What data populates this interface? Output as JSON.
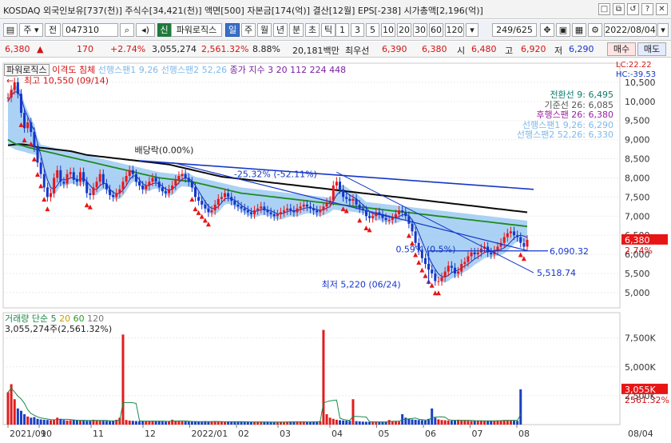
{
  "window": {
    "title": "KOSDAQ 외국인보유[737(천)] 주식수[34,421(천)] 액면[500] 자본금[174(억)] 결산[12월] EPS[-238] 시가총액[2,196(억)]",
    "buttons": [
      "□",
      "⧉",
      "↺",
      "?",
      "✕"
    ]
  },
  "toolbar": {
    "stock_mode": "주",
    "market": "전",
    "code": "047310",
    "chart_name_badge": "신",
    "chart_name": "파워로직스",
    "periods": [
      "일",
      "주",
      "월",
      "년",
      "분",
      "초",
      "틱"
    ],
    "selected_period": "일",
    "intervals": [
      "1",
      "3",
      "5",
      "10",
      "20",
      "30",
      "60",
      "120"
    ],
    "count_value": "249/625",
    "date_value": "2022/08/04"
  },
  "quote": {
    "price": "6,380",
    "change": "170",
    "change_pct": "+2.74%",
    "volume": "3,055,274",
    "volume_ratio": "2,561.32%",
    "turnover": "8.88%",
    "amount": "20,181백만",
    "best_label": "최우선",
    "best_ask": "6,390",
    "best_bid": "6,380",
    "open_label": "시",
    "open": "6,480",
    "high_label": "고",
    "high": "6,920",
    "low_label": "저",
    "low": "6,290",
    "sell_button": "매수",
    "buy_button": "매도"
  },
  "colors": {
    "up": "#e8161a",
    "down": "#1536c8",
    "ma5": "#1a2fb5",
    "ma26": "#0a0a0a",
    "cloud": "#8fc3f0",
    "green_line": "#1f8a1f",
    "volume_up": "#e11d1d",
    "volume_down": "#1b3fc2"
  },
  "chart_data": {
    "type": "line",
    "title": "",
    "price_legend": [
      {
        "text": "파워로직스",
        "color": "#222222"
      },
      {
        "text": "이격도 침체",
        "color": "#d21414"
      },
      {
        "text": "선행스팬1 9,26",
        "color": "#7fb8ea"
      },
      {
        "text": "선행스팬2 52,26",
        "color": "#7fb8ea"
      },
      {
        "text": "종가 지수 3 20 112 224 448",
        "color": "#7a1fa2"
      }
    ],
    "indicator_legend": [
      {
        "text": "전환선 9: 6,495",
        "color": "#0e7a6a"
      },
      {
        "text": "기준선 26: 6,085",
        "color": "#555555"
      },
      {
        "text": "후행스팬 26: 6,380",
        "color": "#9b1fa2"
      },
      {
        "text": "선행스팬1 9,26: 6,290",
        "color": "#7fb8ea"
      },
      {
        "text": "선행스팬2 52,26: 6,330",
        "color": "#7fb8ea"
      }
    ],
    "corner_labels": [
      "LC:22.22",
      "HC:-39.53"
    ],
    "price_axis": {
      "ylim": [
        4600,
        11000
      ],
      "ticks": [
        "10,500",
        "10,000",
        "9,500",
        "9,000",
        "8,500",
        "8,000",
        "7,500",
        "7,000",
        "6,500",
        "6,000",
        "5,500",
        "5,000"
      ],
      "current_price": "6,380",
      "current_pct": "2.74%"
    },
    "x_axis": {
      "ticks": [
        "2021/09",
        "10",
        "11",
        "12",
        "2022/01",
        "02",
        "03",
        "04",
        "05",
        "06",
        "07",
        "08"
      ],
      "right_date": "08/04"
    },
    "annotations": {
      "high": "최고 10,550 (09/14)",
      "low": "최저 5,220 (06/24)",
      "dividend": "배당락(0.00%)",
      "trend_upper": "-25.32% (-52.11%)",
      "trend_mid": "0.59% (0.5%)",
      "level_6090": "6,090.32",
      "level_5518": "5,518.74"
    },
    "close_series": [
      10100,
      10300,
      10500,
      10200,
      9700,
      9300,
      9450,
      9200,
      8800,
      8400,
      8100,
      7750,
      7500,
      7600,
      8000,
      8200,
      7900,
      7850,
      8100,
      8150,
      7950,
      7900,
      8150,
      7900,
      7600,
      7550,
      7750,
      7900,
      8100,
      7850,
      7700,
      7550,
      7500,
      7600,
      7700,
      7900,
      8050,
      8200,
      8100,
      7900,
      7800,
      7700,
      7800,
      7900,
      8000,
      7900,
      7750,
      7650,
      7600,
      7700,
      7800,
      7950,
      8050,
      8100,
      8000,
      7900,
      7750,
      7500,
      7400,
      7300,
      7200,
      7100,
      7150,
      7300,
      7450,
      7500,
      7600,
      7500,
      7400,
      7300,
      7250,
      7200,
      7150,
      7100,
      7050,
      7150,
      7200,
      7250,
      7150,
      7100,
      7050,
      7000,
      7050,
      7100,
      7150,
      7200,
      7150,
      7100,
      7200,
      7250,
      7300,
      7250,
      7200,
      7150,
      7100,
      7150,
      7250,
      7350,
      7400,
      7800,
      7900,
      7700,
      7500,
      7450,
      7400,
      7450,
      7300,
      7200,
      7150,
      7000,
      6950,
      7000,
      7100,
      7050,
      6950,
      6900,
      6900,
      6950,
      7050,
      7150,
      7100,
      7000,
      6800,
      6600,
      6300,
      6100,
      5900,
      5750,
      5600,
      5500,
      5300,
      5300,
      5400,
      5550,
      5700,
      5650,
      5500,
      5550,
      5750,
      5800,
      5950,
      6050,
      6000,
      6050,
      6150,
      6200,
      6050,
      6000,
      6100,
      6200,
      6300,
      6450,
      6550,
      6600,
      6500,
      6450,
      6300,
      6200,
      6380
    ],
    "ma5_series": [
      10000,
      10150,
      10250,
      10250,
      10100,
      9800,
      9600,
      9400,
      9250,
      8900,
      8600,
      8250,
      7950,
      7750,
      7700,
      7800,
      7950,
      7950,
      7950,
      8000,
      8000,
      7950,
      7950,
      8000,
      7900,
      7800,
      7700,
      7700,
      7800,
      7850,
      7850,
      7700,
      7620,
      7580,
      7600,
      7680,
      7800,
      7950,
      8050,
      8050,
      7950,
      7850,
      7800,
      7800,
      7850,
      7870,
      7850,
      7780,
      7700,
      7680,
      7700,
      7780,
      7880,
      7960,
      8000,
      7980,
      7920,
      7800,
      7660,
      7520,
      7380,
      7260,
      7200,
      7200,
      7250,
      7350,
      7450,
      7470,
      7450,
      7410,
      7360,
      7280,
      7230,
      7180,
      7130,
      7120,
      7140,
      7170,
      7180,
      7160,
      7140,
      7100,
      7060,
      7060,
      7080,
      7120,
      7140,
      7140,
      7150,
      7170,
      7200,
      7220,
      7220,
      7200,
      7170,
      7150,
      7170,
      7210,
      7250,
      7400,
      7550,
      7640,
      7660,
      7610,
      7550,
      7500,
      7450,
      7370,
      7300,
      7210,
      7120,
      7070,
      7040,
      7040,
      7020,
      7000,
      6980,
      6960,
      6960,
      6990,
      7030,
      7050,
      7010,
      6900,
      6760,
      6560,
      6340,
      6130,
      5930,
      5760,
      5610,
      5490,
      5420,
      5410,
      5450,
      5520,
      5560,
      5590,
      5640,
      5700,
      5740,
      5810,
      5880,
      5930,
      5990,
      6050,
      6070,
      6080,
      6100,
      6110,
      6130,
      6170,
      6240,
      6330,
      6420,
      6480,
      6500,
      6480,
      6440
    ],
    "ma26_series": [
      8850,
      8860,
      8870,
      8880,
      8880,
      8870,
      8860,
      8840,
      8820,
      8800,
      8790,
      8780,
      8770,
      8760,
      8750,
      8740,
      8730,
      8720,
      8710,
      8700,
      8680,
      8660,
      8640,
      8620,
      8600,
      8590,
      8580,
      8570,
      8560,
      8550,
      8540,
      8530,
      8520,
      8510,
      8500,
      8490,
      8480,
      8470,
      8460,
      8450,
      8440,
      8430,
      8420,
      8410,
      8400,
      8390,
      8380,
      8370,
      8360,
      8350,
      8330,
      8310,
      8290,
      8270,
      8250,
      8230,
      8210,
      8190,
      8170,
      8150,
      8130,
      8110,
      8090,
      8070,
      8050,
      8030,
      8020,
      8010,
      8000,
      7990,
      7980,
      7970,
      7960,
      7950,
      7940,
      7930,
      7920,
      7910,
      7900,
      7890,
      7880,
      7870,
      7860,
      7850,
      7840,
      7830,
      7820,
      7810,
      7800,
      7790,
      7780,
      7770,
      7760,
      7750,
      7740,
      7730,
      7720,
      7710,
      7700,
      7690,
      7680,
      7670,
      7660,
      7650,
      7640,
      7630,
      7620,
      7610,
      7600,
      7590,
      7580,
      7570,
      7560,
      7550,
      7540,
      7530,
      7520,
      7510,
      7500,
      7490,
      7480,
      7470,
      7460,
      7450,
      7440,
      7430,
      7420,
      7410,
      7400,
      7390,
      7380,
      7370,
      7360,
      7350,
      7340,
      7330,
      7320,
      7310,
      7300,
      7290,
      7280,
      7270,
      7260,
      7250,
      7240,
      7230,
      7220,
      7210,
      7200,
      7190,
      7180,
      7170,
      7160,
      7150,
      7140,
      7130,
      7120,
      7110,
      7100
    ],
    "green_series": [
      9000,
      8950,
      8900,
      8870,
      8850,
      8830,
      8800,
      8780,
      8760,
      8740,
      8720,
      8700,
      8680,
      8660,
      8640,
      8620,
      8600,
      8580,
      8560,
      8540,
      8520,
      8500,
      8480,
      8460,
      8440,
      8420,
      8400,
      8380,
      8360,
      8340,
      8320,
      8300,
      8280,
      8260,
      8240,
      8220,
      8200,
      8180,
      8160,
      8140,
      8120,
      8100,
      8080,
      8060,
      8040,
      8020,
      8000,
      7990,
      7980,
      7970,
      7960,
      7950,
      7940,
      7930,
      7920,
      7910,
      7900,
      7880,
      7860,
      7840,
      7820,
      7800,
      7780,
      7760,
      7740,
      7720,
      7700,
      7680,
      7660,
      7640,
      7620,
      7600,
      7590,
      7580,
      7570,
      7560,
      7550,
      7540,
      7530,
      7520,
      7510,
      7500,
      7490,
      7480,
      7470,
      7460,
      7450,
      7440,
      7430,
      7420,
      7410,
      7400,
      7390,
      7380,
      7370,
      7360,
      7350,
      7340,
      7330,
      7320,
      7310,
      7300,
      7290,
      7280,
      7270,
      7260,
      7250,
      7240,
      7230,
      7220,
      7210,
      7200,
      7190,
      7180,
      7170,
      7160,
      7150,
      7140,
      7130,
      7120,
      7110,
      7100,
      7090,
      7080,
      7070,
      7060,
      7050,
      7040,
      7030,
      7020,
      7010,
      7000,
      6990,
      6980,
      6970,
      6960,
      6950,
      6940,
      6930,
      6920,
      6910,
      6900,
      6890,
      6880,
      6870,
      6860,
      6850,
      6840,
      6830,
      6820,
      6810,
      6800,
      6790,
      6780,
      6770,
      6760,
      6750,
      6740,
      6730
    ],
    "volume_legend": [
      {
        "text": "거래량",
        "color": "#1a8a4a"
      },
      {
        "text": "단순 5",
        "color": "#1a8a4a"
      },
      {
        "text": "20",
        "color": "#c8a000"
      },
      {
        "text": "60",
        "color": "#2a9a2a"
      },
      {
        "text": "120",
        "color": "#777777"
      }
    ],
    "volume_label": "3,055,274주(2,561.32%)",
    "volume_axis": {
      "ylim": [
        0,
        9000
      ],
      "ticks": [
        "7,500K",
        "5,000K",
        "2,500K"
      ],
      "current": "3,055K",
      "current_pct": "2561.32%"
    },
    "volume_series": [
      2800,
      3500,
      2200,
      1400,
      1200,
      900,
      700,
      600,
      650,
      500,
      450,
      420,
      400,
      380,
      420,
      600,
      500,
      400,
      350,
      380,
      400,
      380,
      360,
      350,
      330,
      340,
      420,
      380,
      360,
      340,
      320,
      300,
      320,
      420,
      600,
      7800,
      400,
      350,
      330,
      310,
      300,
      280,
      300,
      320,
      340,
      300,
      280,
      270,
      260,
      300,
      420,
      320,
      300,
      290,
      280,
      270,
      260,
      250,
      240,
      260,
      300,
      280,
      270,
      260,
      250,
      240,
      230,
      250,
      260,
      270,
      250,
      240,
      230,
      220,
      230,
      240,
      250,
      240,
      230,
      220,
      210,
      230,
      240,
      230,
      220,
      240,
      260,
      250,
      240,
      230,
      220,
      240,
      250,
      260,
      280,
      300,
      8200,
      900,
      600,
      500,
      420,
      380,
      360,
      340,
      330,
      2200,
      300,
      280,
      260,
      250,
      240,
      230,
      220,
      230,
      240,
      250,
      400,
      300,
      280,
      260,
      900,
      600,
      500,
      450,
      420,
      400,
      380,
      360,
      500,
      1400,
      600,
      450,
      400,
      380,
      360,
      340,
      380,
      420,
      380,
      360,
      340,
      320,
      330,
      340,
      350,
      330,
      320,
      330,
      340,
      360,
      380,
      400,
      380,
      360,
      340,
      320,
      3055
    ]
  }
}
